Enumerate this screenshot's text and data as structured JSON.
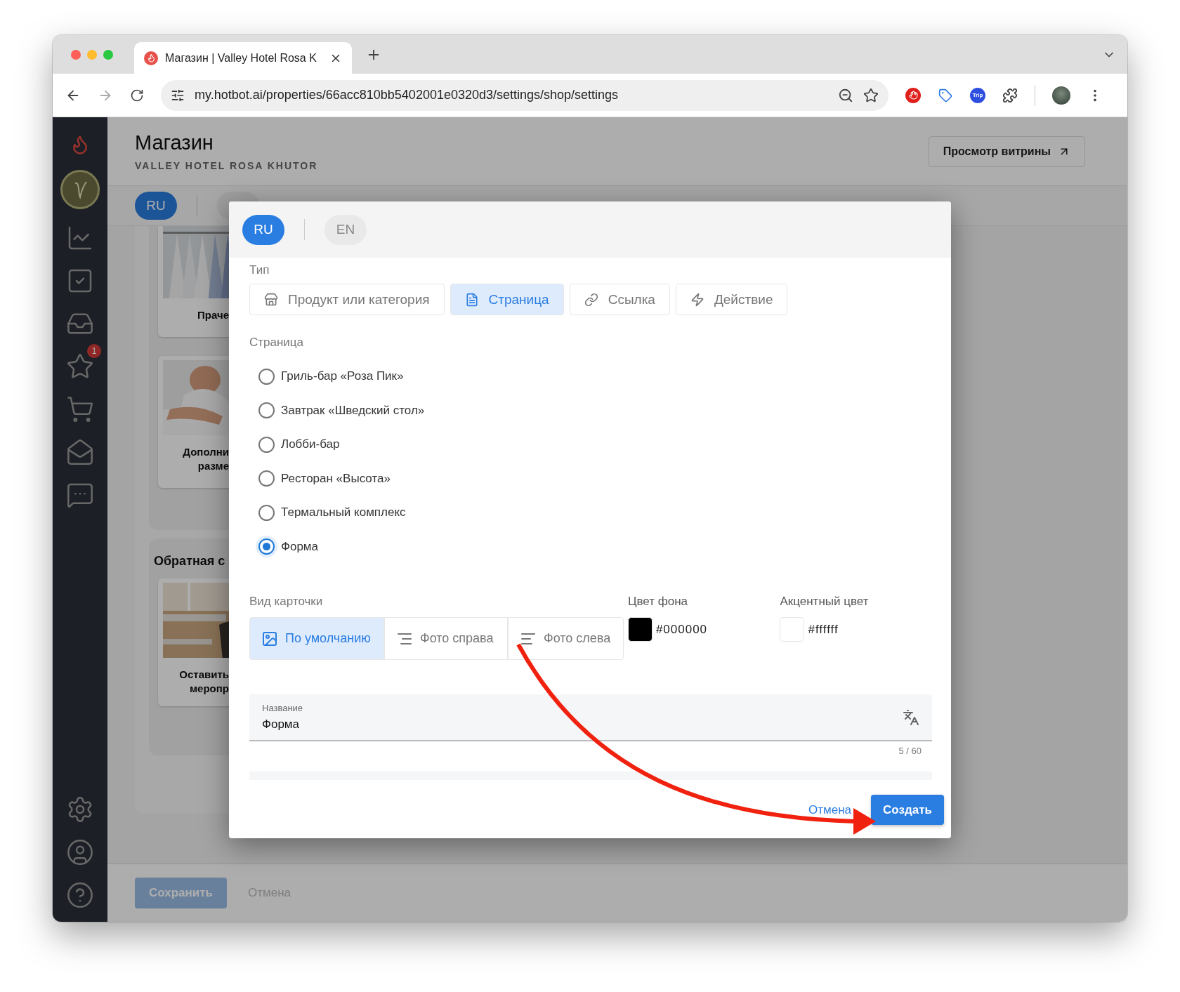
{
  "browser": {
    "tab_title": "Магазин | Valley Hotel Rosa K",
    "url": "my.hotbot.ai/properties/66acc810bb5402001e0320d3/settings/shop/settings",
    "extension_label": "Trip"
  },
  "sidebar": {
    "badge": "1"
  },
  "page": {
    "title": "Магазин",
    "subtitle": "VALLEY HOTEL ROSA KHUTOR",
    "preview_button": "Просмотр витрины",
    "languages": [
      {
        "label": "RU",
        "selected": true
      }
    ],
    "sections": [
      {
        "cards": [
          {
            "kind": "picture",
            "lines": [
              "Праче"
            ]
          },
          {
            "kind": "picture",
            "lines": [
              "Дополни",
              "разме"
            ]
          }
        ]
      },
      {
        "title": "Обратная с",
        "cards": [
          {
            "kind": "picture",
            "lines": [
              "Оставить",
              "меропр"
            ]
          }
        ]
      }
    ],
    "save_button": "Сохранить",
    "cancel_button": "Отмена"
  },
  "modal": {
    "languages": [
      {
        "label": "RU",
        "selected": true
      },
      {
        "label": "EN",
        "selected": false
      }
    ],
    "type_label": "Тип",
    "types": [
      {
        "label": "Продукт или категория",
        "selected": false
      },
      {
        "label": "Страница",
        "selected": true
      },
      {
        "label": "Ссылка",
        "selected": false
      },
      {
        "label": "Действие",
        "selected": false
      }
    ],
    "page_label": "Страница",
    "pages": [
      {
        "label": "Гриль-бар «Роза Пик»",
        "selected": false
      },
      {
        "label": "Завтрак «Шведский стол»",
        "selected": false
      },
      {
        "label": "Лобби-бар",
        "selected": false
      },
      {
        "label": "Ресторан «Высота»",
        "selected": false
      },
      {
        "label": "Термальный комплекс",
        "selected": false
      },
      {
        "label": "Форма",
        "selected": true
      }
    ],
    "card_view_label": "Вид карточки",
    "card_views": [
      {
        "label": "По умолчанию",
        "selected": true
      },
      {
        "label": "Фото справа",
        "selected": false
      },
      {
        "label": "Фото слева",
        "selected": false
      }
    ],
    "colors": [
      {
        "label": "Цвет фона",
        "value": "#000000"
      },
      {
        "label": "Акцентный цвет",
        "value": "#ffffff"
      }
    ],
    "name_field": {
      "label": "Название",
      "value": "Форма",
      "counter": "5 / 60"
    },
    "cancel_button": "Отмена",
    "create_button": "Создать"
  }
}
